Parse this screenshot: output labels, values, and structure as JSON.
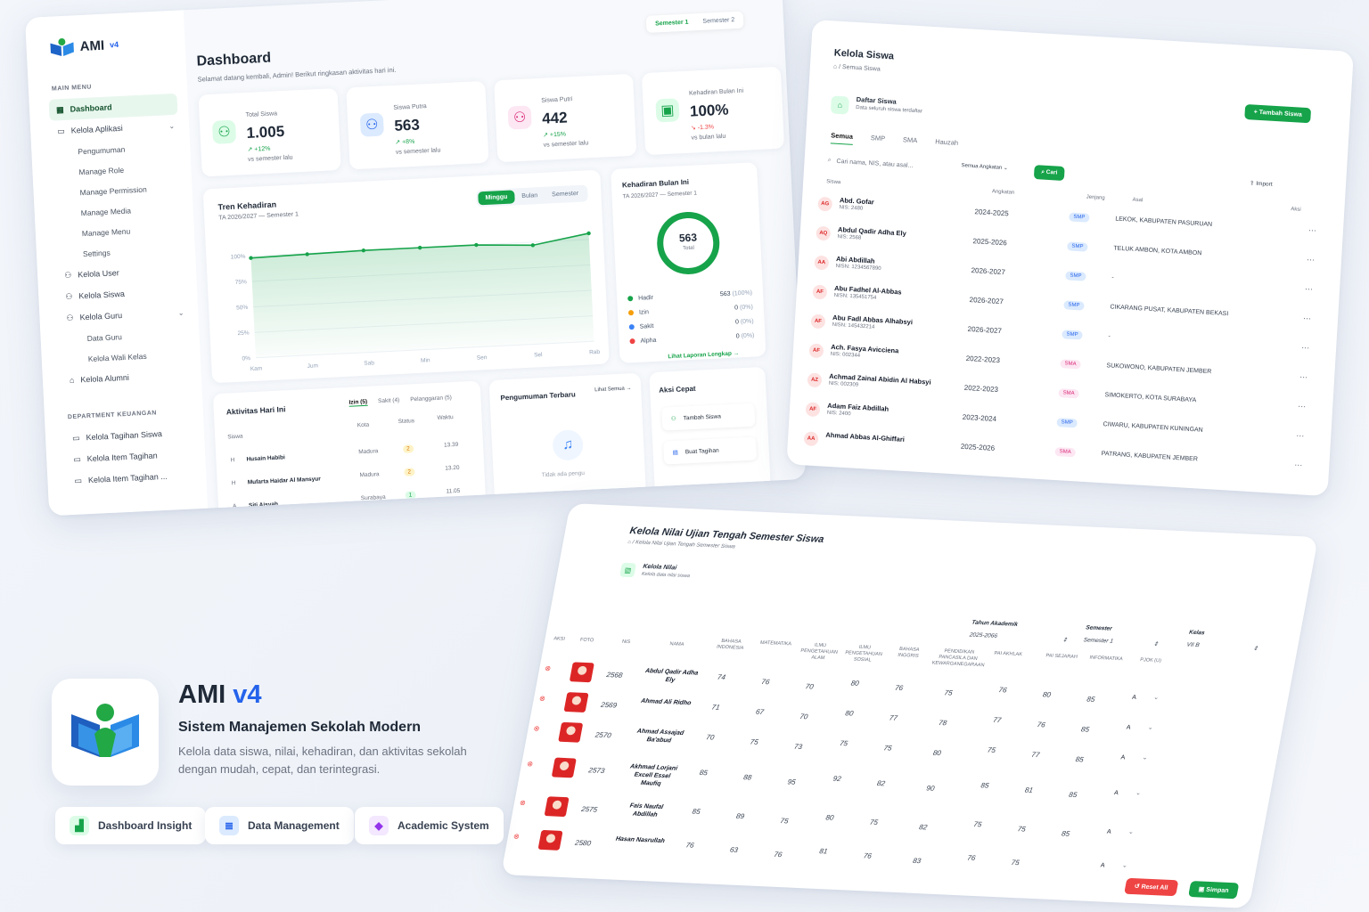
{
  "dashboard": {
    "brand": "AMI",
    "brand_version": "v4",
    "main_menu_label": "MAIN MENU",
    "menu": [
      {
        "label": "Dashboard"
      },
      {
        "label": "Kelola Aplikasi"
      },
      {
        "label": "Pengumuman"
      },
      {
        "label": "Manage Role"
      },
      {
        "label": "Manage Permission"
      },
      {
        "label": "Manage Media"
      },
      {
        "label": "Manage Menu"
      },
      {
        "label": "Settings"
      },
      {
        "label": "Kelola User"
      },
      {
        "label": "Kelola Siswa"
      },
      {
        "label": "Kelola Guru"
      },
      {
        "label": "Data Guru"
      },
      {
        "label": "Kelola Wali Kelas"
      },
      {
        "label": "Kelola Alumni"
      }
    ],
    "finance_section_label": "DEPARTMENT KEUANGAN",
    "finance_menu": [
      {
        "label": "Kelola Tagihan Siswa"
      },
      {
        "label": "Kelola Item Tagihan"
      },
      {
        "label": "Kelola Item Tagihan ..."
      }
    ],
    "title": "Dashboard",
    "subtitle": "Selamat datang kembali, Admin! Berikut ringkasan aktivitas hari ini.",
    "semester_tabs": [
      "Semester 1",
      "Semester 2"
    ],
    "stats": [
      {
        "label": "Total Siswa",
        "value": "1.005",
        "change": "↗ +12%",
        "note": "vs semester lalu"
      },
      {
        "label": "Siswa Putra",
        "value": "563",
        "change": "↗ +8%",
        "note": "vs semester lalu"
      },
      {
        "label": "Siswa Putri",
        "value": "442",
        "change": "↗ +15%",
        "note": "vs semester lalu"
      },
      {
        "label": "Kehadiran Bulan Ini",
        "value": "100%",
        "change": "↘ -1.3%",
        "note": "vs bulan lalu"
      }
    ],
    "trend": {
      "title": "Tren Kehadiran",
      "subtitle": "TA 2026/2027 — Semester 1",
      "tabs": [
        "Minggu",
        "Bulan",
        "Semester"
      ]
    },
    "chart_data": {
      "type": "area",
      "title": "Tren Kehadiran",
      "categories": [
        "Kam",
        "Jum",
        "Sab",
        "Min",
        "Sen",
        "Sel",
        "Rab"
      ],
      "values": [
        98,
        99,
        100,
        100,
        100,
        97,
        106
      ],
      "y_ticks": [
        "100%",
        "75%",
        "50%",
        "25%",
        "0%"
      ],
      "ylim": [
        0,
        110
      ]
    },
    "donut": {
      "title": "Kehadiran Bulan Ini",
      "subtitle": "TA 2026/2027 — Semester 1",
      "center_value": "563",
      "center_label": "Total",
      "legend": [
        {
          "label": "Hadir",
          "value": "563",
          "pct": "(100%)",
          "color": "#16a34a"
        },
        {
          "label": "Izin",
          "value": "0",
          "pct": "(0%)",
          "color": "#f59e0b"
        },
        {
          "label": "Sakit",
          "value": "0",
          "pct": "(0%)",
          "color": "#3b82f6"
        },
        {
          "label": "Alpha",
          "value": "0",
          "pct": "(0%)",
          "color": "#ef4444"
        }
      ],
      "link": "Lihat Laporan Lengkap →"
    },
    "activity": {
      "title": "Aktivitas Hari Ini",
      "tabs": [
        "Izin (5)",
        "Sakit (4)",
        "Pelanggaran (5)"
      ],
      "headers": [
        "Siswa",
        "Kota",
        "Status",
        "Waktu"
      ],
      "rows": [
        {
          "initial": "H",
          "name": "Husain Habibi",
          "city": "Madura",
          "status": "2",
          "time": "13.39"
        },
        {
          "initial": "H",
          "name": "Mufarta Haidar Al Mansyur",
          "city": "Madura",
          "status": "2",
          "time": "13.20"
        },
        {
          "initial": "A",
          "name": "Siti Aisyah",
          "city": "Surabaya",
          "status": "1",
          "time": "11.05"
        }
      ],
      "link": "Lihat semua aktivitas →"
    },
    "announcement": {
      "title": "Pengumuman Terbaru",
      "link": "Lihat Semua →",
      "empty": "Tidak ada pengu"
    },
    "quick": {
      "title": "Aksi Cepat",
      "items": [
        "Tambah Siswa",
        "Buat Tagihan"
      ]
    }
  },
  "siswa": {
    "title": "Kelola Siswa",
    "breadcrumb": "Semua Siswa",
    "list_title": "Daftar Siswa",
    "list_sub": "Data seluruh siswa terdaftar",
    "add_button": "+  Tambah Siswa",
    "tabs": [
      "Semua",
      "SMP",
      "SMA",
      "Hauzah"
    ],
    "search_placeholder": "Cari nama, NIS, atau asal...",
    "filter": "Semua Angkatan",
    "search_button": "Cari",
    "import_button": "Import",
    "headers": [
      "Siswa",
      "Angkatan",
      "Jenjang",
      "Asal",
      "Aksi"
    ],
    "rows": [
      {
        "av": "AG",
        "name": "Abd. Gofar",
        "nis": "NIS: 2480",
        "year": "2024-2025",
        "level": "SMP",
        "origin": "LEKOK, KABUPATEN PASURUAN"
      },
      {
        "av": "AQ",
        "name": "Abdul Qadir Adha Ely",
        "nis": "NIS: 2568",
        "year": "2025-2026",
        "level": "SMP",
        "origin": "TELUK AMBON, KOTA AMBON"
      },
      {
        "av": "AA",
        "name": "Abi Abdillah",
        "nis": "NISN: 1234567890",
        "year": "2026-2027",
        "level": "SMP",
        "origin": "-"
      },
      {
        "av": "AF",
        "name": "Abu Fadhel Al-Abbas",
        "nis": "NISN: 135451754",
        "year": "2026-2027",
        "level": "SMP",
        "origin": "CIKARANG PUSAT, KABUPATEN BEKASI"
      },
      {
        "av": "AF",
        "name": "Abu Fadl Abbas Alhabsyi",
        "nis": "NISN: 145432214",
        "year": "2026-2027",
        "level": "SMP",
        "origin": "-"
      },
      {
        "av": "AF",
        "name": "Ach. Fasya Avicciena",
        "nis": "NIS: 002344",
        "year": "2022-2023",
        "level": "SMA",
        "origin": "SUKOWONO, KABUPATEN JEMBER"
      },
      {
        "av": "AZ",
        "name": "Achmad Zainal Abidin Al Habsyi",
        "nis": "NIS: 002309",
        "year": "2022-2023",
        "level": "SMA",
        "origin": "SIMOKERTO, KOTA SURABAYA"
      },
      {
        "av": "AF",
        "name": "Adam Faiz Abdillah",
        "nis": "NIS: 2400",
        "year": "2023-2024",
        "level": "SMP",
        "origin": "CIWARU, KABUPATEN KUNINGAN"
      },
      {
        "av": "AA",
        "name": "Ahmad Abbas Al-Ghiffari",
        "nis": "",
        "year": "2025-2026",
        "level": "SMA",
        "origin": "PATRANG, KABUPATEN JEMBER"
      }
    ]
  },
  "nilai": {
    "title": "Kelola Nilai Ujian Tengah Semester Siswa",
    "breadcrumb": "Kelola Nilai Ujian Tengah Semester Siswa",
    "card_title": "Kelola Nilai",
    "card_sub": "Kelola data nilai siswa",
    "filters": [
      {
        "label": "Tahun Akademik",
        "value": "2025-2066"
      },
      {
        "label": "Semester",
        "value": "Semester 1"
      },
      {
        "label": "Kelas",
        "value": "VII B"
      }
    ],
    "headers": [
      "Aksi",
      "Foto",
      "NIS",
      "Nama",
      "Bahasa Indonesia",
      "Matematika",
      "Ilmu Pengetahuan Alam",
      "Ilmu Pengetahuan Sosial",
      "Bahasa Inggris",
      "Pendidikan Pancasila dan Kewarganegaraan",
      "PAI Akhlak",
      "PAI Sejarah",
      "Informatika",
      "PJOK (U)"
    ],
    "rows": [
      {
        "nis": "2568",
        "name": "Abdul Qadir Adha Ely",
        "scores": [
          "74",
          "76",
          "70",
          "80",
          "76",
          "75",
          "76",
          "80",
          "85"
        ],
        "grade": "A"
      },
      {
        "nis": "2569",
        "name": "Ahmad Ali Ridho",
        "scores": [
          "71",
          "67",
          "70",
          "80",
          "77",
          "78",
          "77",
          "76",
          "85"
        ],
        "grade": "A"
      },
      {
        "nis": "2570",
        "name": "Ahmad Assajad Ba'abud",
        "scores": [
          "70",
          "75",
          "73",
          "75",
          "75",
          "80",
          "75",
          "77",
          "85"
        ],
        "grade": "A"
      },
      {
        "nis": "2573",
        "name": "Akhmad Lorjani Excell Essel Maufiq",
        "scores": [
          "85",
          "88",
          "95",
          "92",
          "82",
          "90",
          "85",
          "81",
          "85"
        ],
        "grade": "A"
      },
      {
        "nis": "2575",
        "name": "Fais Naufal Abdillah",
        "scores": [
          "85",
          "89",
          "75",
          "80",
          "75",
          "82",
          "75",
          "75",
          "85"
        ],
        "grade": "A"
      },
      {
        "nis": "2580",
        "name": "Hasan Nasrullah",
        "scores": [
          "76",
          "63",
          "76",
          "81",
          "76",
          "83",
          "76",
          "75",
          ""
        ],
        "grade": "A"
      }
    ],
    "reset_button": "Reset All",
    "save_button": "Simpan"
  },
  "hero": {
    "name": "AMI",
    "version": "v4",
    "tagline": "Sistem Manajemen Sekolah Modern",
    "desc_line1": "Kelola data siswa, nilai, kehadiran, dan aktivitas sekolah",
    "desc_line2": "dengan mudah, cepat, dan terintegrasi.",
    "features": [
      "Dashboard Insight",
      "Data Management",
      "Academic System"
    ]
  },
  "colors": {
    "accent": "#16a34a",
    "brand_blue": "#2563eb",
    "danger": "#ef4444"
  }
}
